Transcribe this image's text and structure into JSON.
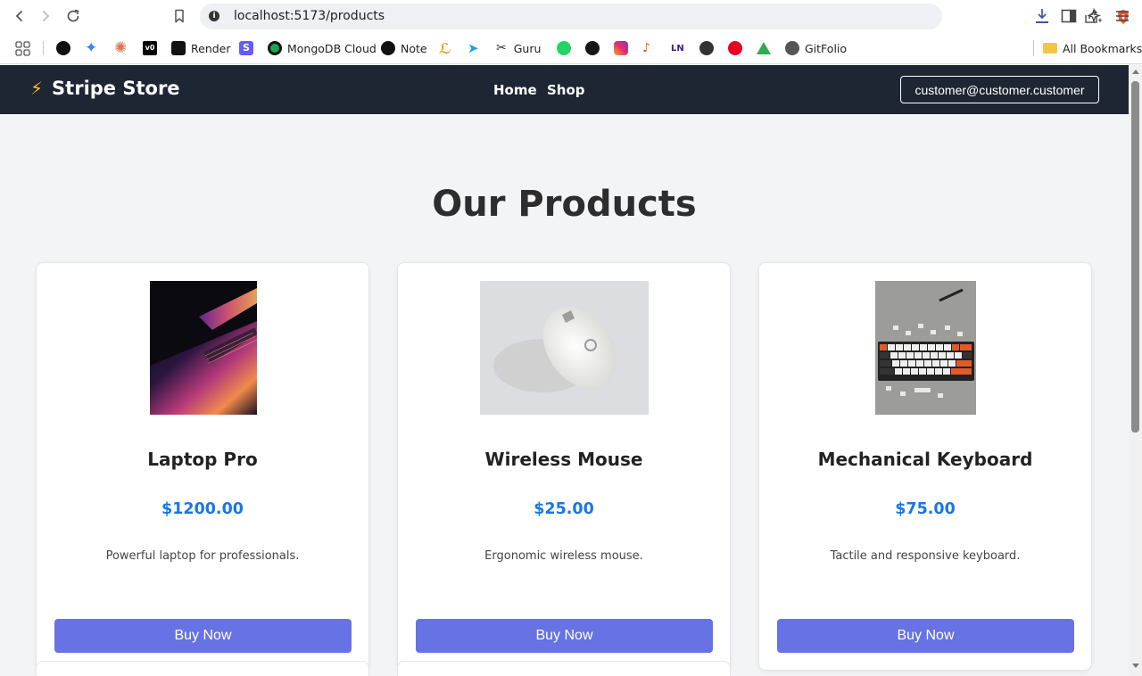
{
  "browser": {
    "url": "localhost:5173/products",
    "bookmarks": [
      {
        "label": "",
        "icon": "openai-icon",
        "color": "#111111"
      },
      {
        "label": "",
        "icon": "gemini-icon",
        "color": "#3b82f6"
      },
      {
        "label": "",
        "icon": "claude-icon",
        "color": "#d97757"
      },
      {
        "label": "",
        "icon": "v0-icon",
        "color": "#000000"
      },
      {
        "label": "Render",
        "icon": "render-icon",
        "color": "#111111"
      },
      {
        "label": "",
        "icon": "stripe-icon",
        "color": "#635bff"
      },
      {
        "label": "MongoDB Cloud",
        "icon": "mongodb-icon",
        "color": "#13aa52"
      },
      {
        "label": "Note",
        "icon": "note-icon",
        "color": "#111111"
      },
      {
        "label": "",
        "icon": "arc-icon",
        "color": "#e4a11b"
      },
      {
        "label": "",
        "icon": "bird-icon",
        "color": "#1da1f2"
      },
      {
        "label": "Guru",
        "icon": "guru-icon",
        "color": "#333333"
      },
      {
        "label": "",
        "icon": "whatsapp-icon",
        "color": "#25d366"
      },
      {
        "label": "",
        "icon": "github-icon",
        "color": "#181717"
      },
      {
        "label": "",
        "icon": "instagram-icon",
        "color": "#e1306c"
      },
      {
        "label": "",
        "icon": "music-icon",
        "color": "#ff5500"
      },
      {
        "label": "",
        "icon": "ln-icon",
        "color": "#3b1f8a"
      },
      {
        "label": "",
        "icon": "circle-icon",
        "color": "#333333"
      },
      {
        "label": "",
        "icon": "pinterest-icon",
        "color": "#e60023"
      },
      {
        "label": "",
        "icon": "drive-icon",
        "color": "#34a853"
      },
      {
        "label": "GitFolio",
        "icon": "globe-icon",
        "color": "#555555"
      }
    ],
    "all_bookmarks": "All Bookmarks"
  },
  "header": {
    "brand": "Stripe Store",
    "brand_icon": "⚡",
    "nav": [
      "Home",
      "Shop"
    ],
    "user": "customer@customer.customer"
  },
  "main": {
    "title": "Our Products",
    "products": [
      {
        "name": "Laptop Pro",
        "price": "$1200.00",
        "description": "Powerful laptop for professionals.",
        "button": "Buy Now",
        "image": "laptop-image"
      },
      {
        "name": "Wireless Mouse",
        "price": "$25.00",
        "description": "Ergonomic wireless mouse.",
        "button": "Buy Now",
        "image": "mouse-image"
      },
      {
        "name": "Mechanical Keyboard",
        "price": "$75.00",
        "description": "Tactile and responsive keyboard.",
        "button": "Buy Now",
        "image": "keyboard-image"
      }
    ]
  },
  "colors": {
    "header_bg": "#1e2533",
    "accent_button": "#6772e5",
    "price": "#1877e8",
    "page_bg": "#f3f4f6"
  }
}
